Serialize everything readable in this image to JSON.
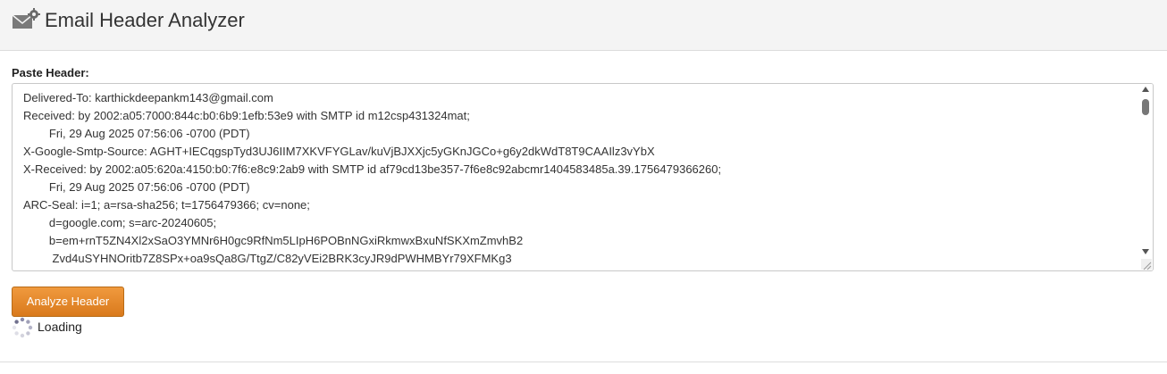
{
  "app": {
    "title": "Email Header Analyzer",
    "logo_icon": "envelope-gear-icon"
  },
  "form": {
    "label": "Paste Header:",
    "header_text": "Delivered-To: karthickdeepankm143@gmail.com\nReceived: by 2002:a05:7000:844c:b0:6b9:1efb:53e9 with SMTP id m12csp431324mat;\n        Fri, 29 Aug 2025 07:56:06 -0700 (PDT)\nX-Google-Smtp-Source: AGHT+IECqgspTyd3UJ6IIM7XKVFYGLav/kuVjBJXXjc5yGKnJGCo+g6y2dkWdT8T9CAAIlz3vYbX\nX-Received: by 2002:a05:620a:4150:b0:7f6:e8c9:2ab9 with SMTP id af79cd13be357-7f6e8c92abcmr1404583485a.39.1756479366260;\n        Fri, 29 Aug 2025 07:56:06 -0700 (PDT)\nARC-Seal: i=1; a=rsa-sha256; t=1756479366; cv=none;\n        d=google.com; s=arc-20240605;\n        b=em+rnT5ZN4Xl2xSaO3YMNr6H0gc9RfNm5LIpH6POBnNGxiRkmwxBxuNfSKXmZmvhB2\n         Zvd4uSYHNOritb7Z8SPx+oa9sQa8G/TtgZ/C82yVEi2BRK3cyJR9dPWHMBYr79XFMKg3",
    "analyze_button": "Analyze Header",
    "loading_text": "Loading"
  },
  "colors": {
    "button": "#e8882a",
    "header_bg": "#f4f4f4"
  }
}
